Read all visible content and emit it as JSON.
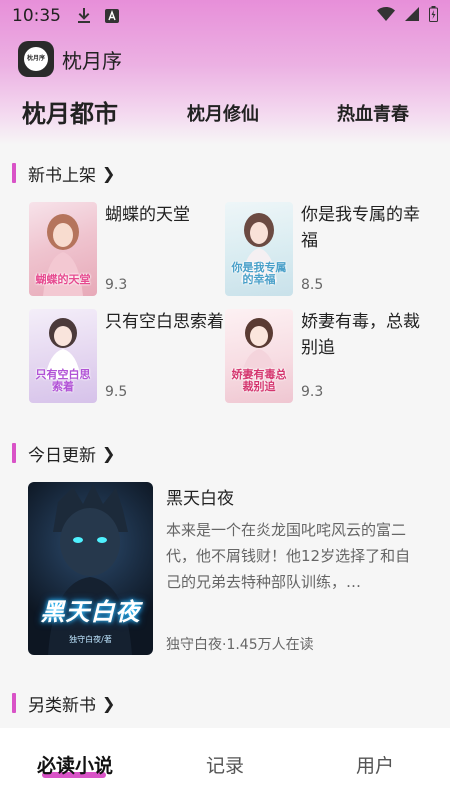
{
  "status_bar": {
    "time": "10:35",
    "icons": [
      "download-icon",
      "a-letter-icon",
      "wifi-icon",
      "signal-icon",
      "battery-icon"
    ]
  },
  "app": {
    "logo_text": "枕月序",
    "title": "枕月序"
  },
  "top_tabs": [
    {
      "label": "枕月都市",
      "active": true
    },
    {
      "label": "枕月修仙",
      "active": false
    },
    {
      "label": "热血青春",
      "active": false
    }
  ],
  "sections": {
    "new_books": {
      "title": "新书上架",
      "books": [
        {
          "title": "蝴蝶的天堂",
          "score": "9.3",
          "cover_text": "蝴蝶的天堂"
        },
        {
          "title": "你是我专属的幸福",
          "score": "8.5",
          "cover_text": "你是我专属的幸福"
        },
        {
          "title": "只有空白思索着",
          "score": "9.5",
          "cover_text": "只有空白思索着"
        },
        {
          "title": "娇妻有毒，总裁别追",
          "score": "9.3",
          "cover_text": "娇妻有毒总裁别追"
        }
      ]
    },
    "today_update": {
      "title": "今日更新",
      "book": {
        "title": "黑天白夜",
        "description": "本来是一个在炎龙国叱咤风云的富二代，他不屑钱财！他12岁选择了和自己的兄弟去特种部队训练，…",
        "meta": "独守白夜·1.45万人在读",
        "cover_title": "黑天白夜",
        "cover_author": "独守白夜/著"
      }
    },
    "alt_new": {
      "title": "另类新书"
    }
  },
  "bottom_nav": [
    {
      "label": "必读小说",
      "active": true
    },
    {
      "label": "记录",
      "active": false
    },
    {
      "label": "用户",
      "active": false
    }
  ],
  "colors": {
    "accent": "#d953c7",
    "header_gradient_top": "#e78fd9",
    "background": "#f6f6f6"
  }
}
